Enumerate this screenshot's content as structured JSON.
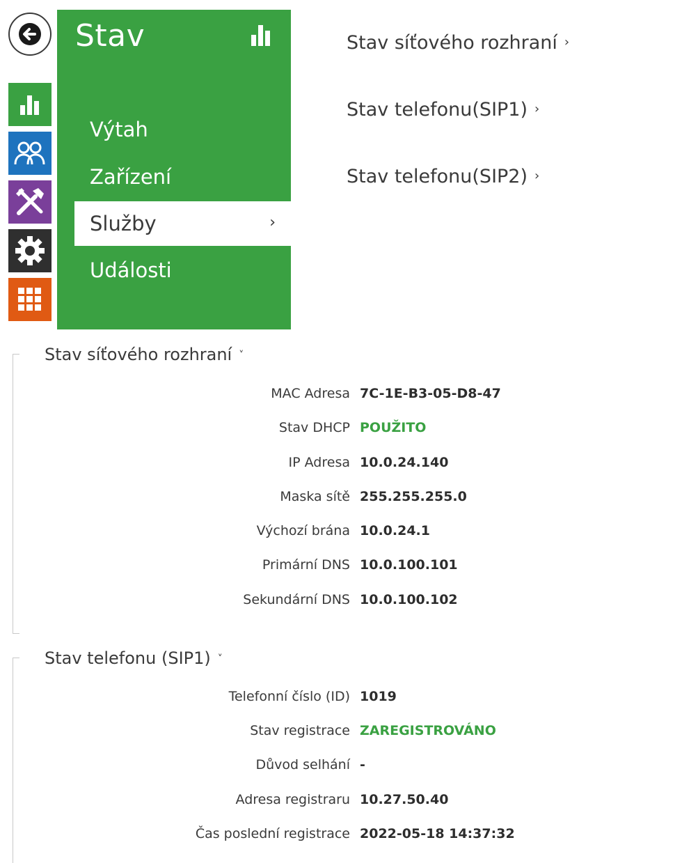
{
  "nav": {
    "back_icon": "arrow-left-icon",
    "rail": [
      {
        "name": "status",
        "icon": "bar-chart-icon",
        "color": "#3aa142"
      },
      {
        "name": "users",
        "icon": "users-icon",
        "color": "#1e73be"
      },
      {
        "name": "tools",
        "icon": "tools-icon",
        "color": "#7a3f9a"
      },
      {
        "name": "settings",
        "icon": "gear-icon",
        "color": "#2f2f2f"
      },
      {
        "name": "apps",
        "icon": "grid-icon",
        "color": "#e05a13"
      }
    ]
  },
  "panel": {
    "title": "Stav",
    "color": "#3aa142",
    "menu": [
      {
        "label": "Výtah",
        "active": false
      },
      {
        "label": "Zařízení",
        "active": false
      },
      {
        "label": "Služby",
        "active": true
      },
      {
        "label": "Události",
        "active": false
      }
    ],
    "active_chevron": "›"
  },
  "links": [
    {
      "label": "Stav síťového rozhraní",
      "chevron": "›"
    },
    {
      "label": "Stav telefonu(SIP1)",
      "chevron": "›"
    },
    {
      "label": "Stav telefonu(SIP2)",
      "chevron": "›"
    }
  ],
  "network": {
    "title": "Stav síťového rozhraní",
    "chevron": "˅",
    "rows": [
      {
        "label": "MAC Adresa",
        "value": "7C-1E-B3-05-D8-47"
      },
      {
        "label": "Stav DHCP",
        "value": "POUŽITO"
      },
      {
        "label": "IP Adresa",
        "value": "10.0.24.140"
      },
      {
        "label": "Maska sítě",
        "value": "255.255.255.0"
      },
      {
        "label": "Výchozí brána",
        "value": "10.0.24.1"
      },
      {
        "label": "Primární DNS",
        "value": "10.0.100.101"
      },
      {
        "label": "Sekundární DNS",
        "value": "10.0.100.102"
      }
    ]
  },
  "sip1": {
    "title": "Stav telefonu (SIP1)",
    "chevron": "˅",
    "rows": [
      {
        "label": "Telefonní číslo (ID)",
        "value": "1019"
      },
      {
        "label": "Stav registrace",
        "value": "ZAREGISTROVÁNO"
      },
      {
        "label": "Důvod selhání",
        "value": "-"
      },
      {
        "label": "Adresa registraru",
        "value": "10.27.50.40"
      },
      {
        "label": "Čas poslední registrace",
        "value": "2022-05-18 14:37:32"
      }
    ]
  },
  "colors": {
    "accent_green": "#3aa142",
    "status_ok": "#3aa142"
  }
}
